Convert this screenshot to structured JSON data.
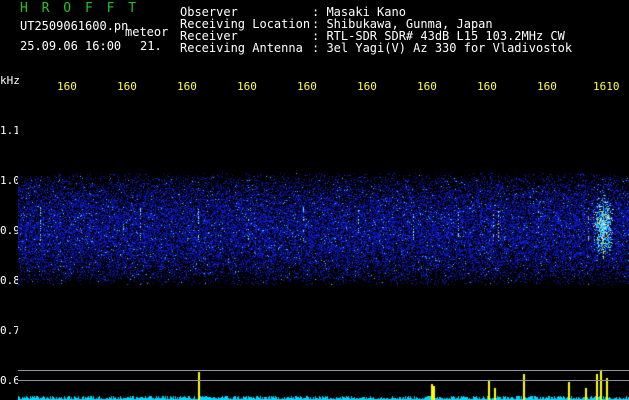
{
  "header": {
    "title": "HROFFT",
    "file_name": "UT2509061600.pn",
    "file_tag": "meteor",
    "datetime": "25.09.06 16:00",
    "count": "21.",
    "info_labels": [
      "Observer",
      "Receiving Location",
      "Receiver",
      "Receiving Antenna"
    ],
    "info_values": [
      ": Masaki Kano",
      ": Shibukawa, Gunma, Japan",
      ": RTL-SDR SDR# 43dB L15 103.2MHz CW",
      ": 3el Yagi(V) Az 330 for Vladivostok"
    ]
  },
  "axes": {
    "y_unit": "kHz",
    "y_ticks": [
      "1.1",
      "1.0",
      "0.9",
      "0.8",
      "0.7",
      "0.6"
    ],
    "x_ticks": [
      "160",
      "160",
      "160",
      "160",
      "160",
      "160",
      "160",
      "160",
      "160",
      "1610"
    ]
  },
  "colors": {
    "title": "#22c322",
    "tick": "#ffff40",
    "baseline": "#00d8ff",
    "meteor": "#ffff00"
  }
}
